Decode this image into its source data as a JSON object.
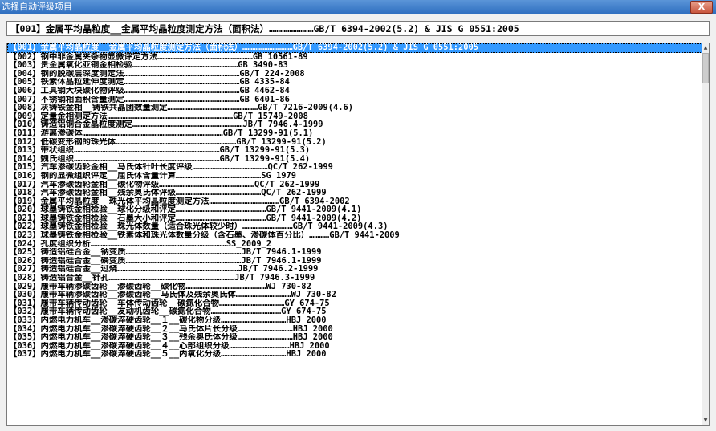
{
  "window": {
    "title": "选择自动评级项目",
    "close_glyph": "X"
  },
  "selected": "【001】金属平均晶粒度__金属平均晶粒度测定方法（面积法）……………………GB/T 6394-2002(5.2) & JIS G 0551:2005",
  "items": [
    "【001】金属平均晶粒度__金属平均晶粒度测定方法（面积法）…………………………GB/T 6394-2002(5.2) & JIS G 0551:2005",
    "【002】钢中非金属夹杂物显微评定方法…………………………………………………GB 10561-89",
    "【003】贵金属氧化亚铜金相检验………………………………………………………GB 3490-83",
    "【004】钢的脱碳层深度测定法……………………………………………………………GB/T 224-2008",
    "【005】铁素体晶粒延伸度测定……………………………………………………………GB 4335-84",
    "【006】工具钢大块碳化物评级……………………………………………………………GB 4462-84",
    "【007】不锈钢相面积含量测定……………………………………………………………GB 6401-86",
    "【008】灰铸铁金相__铸铁共晶团数量测定………………………………………………GB/T 7216-2009(4.6)",
    "【009】定量金相测定方法…………………………………………………………………GB/T 15749-2008",
    "【010】铸造铝铜合金晶粒度测定…………………………………………………………JB/T 7946.4-1999",
    "【011】游离渗碳体…………………………………………………………………………GB/T 13299-91(5.1)",
    "【012】低碳变形钢的珠光体………………………………………………………………GB/T 13299-91(5.2)",
    "【013】带状组织……………………………………………………………………………GB/T 13299-91(5.3)",
    "【014】魏氏组织……………………………………………………………………………GB/T 13299-91(5.4)",
    "【015】汽车渗碳齿轮金相__马氏体针叶长度评级………………………………………QC/T 262-1999",
    "【016】钢的显微组织评定__屈氏体含量计算……………………………………………SG 1979",
    "【017】汽车渗碳齿轮金相__碳化物评级…………………………………………………QC/T 262-1999",
    "【018】汽车渗碳齿轮金相__残余奥氏体评级……………………………………………QC/T 262-1999",
    "【019】金属平均晶粒度__珠光体平均晶粒度测定方法……………………………………GB/T 6394-2002",
    "【020】球墨铸铁金相检验__球化分级和评定………………………………………………GB/T 9441-2009(4.1)",
    "【021】球墨铸铁金相检验__石墨大小和评定………………………………………………GB/T 9441-2009(4.2)",
    "【022】球墨铸铁金相检验__珠光体数量（适合珠光体较少时）…………………………GB/T 9441-2009(4.3)",
    "【023】球墨铸铁金相检验__铁素体和珠光体数量分级（含石墨、渗碳体百分比）…………GB/T 9441-2009",
    "【024】孔度组织分析………………………………………………………………………SS_2009_2",
    "【025】铸造铝硅合金__钠变质……………………………………………………………JB/T 7946.1-1999",
    "【026】铸造铝硅合金__磷变质……………………………………………………………JB/T 7946.1-1999",
    "【027】铸造铝硅合金__过烧………………………………………………………………JB/T 7946.2-1999",
    "【028】铸造铝合金__针孔…………………………………………………………………JB/T 7946.3-1999",
    "【029】履带车辆渗碳齿轮__渗碳齿轮__碳化物…………………………………………WJ 730-82",
    "【030】履带车辆渗碳齿轮__渗碳齿轮__马氏体及残余奥氏体……………………………WJ 730-82",
    "【031】履带车辆传动齿轮__车体传动齿轮__碳氮化合物…………………………………GY 674-75",
    "【032】履带车辆传动齿轮__友动机齿轮__碳氮化合物……………………………………GY 674-75",
    "【033】内燃电力机车__渗碳淬硬齿轮__１__碳化物分级…………………………………HBJ 2000",
    "【034】内燃电力机车__渗碳淬硬齿轮__２__马氏体片长分级……………………………HBJ 2000",
    "【035】内燃电力机车__渗碳淬硬齿轮__３__残余奥氏体分级……………………………HBJ 2000",
    "【036】内燃电力机车__渗碳淬硬齿轮__４__心部组织分级………………………………HBJ 2000",
    "【037】内燃电力机车__渗碳淬硬齿轮__５__内氧化分级…………………………………HBJ 2000"
  ],
  "scrollbar": {
    "up_glyph": "▲",
    "down_glyph": "▼"
  }
}
